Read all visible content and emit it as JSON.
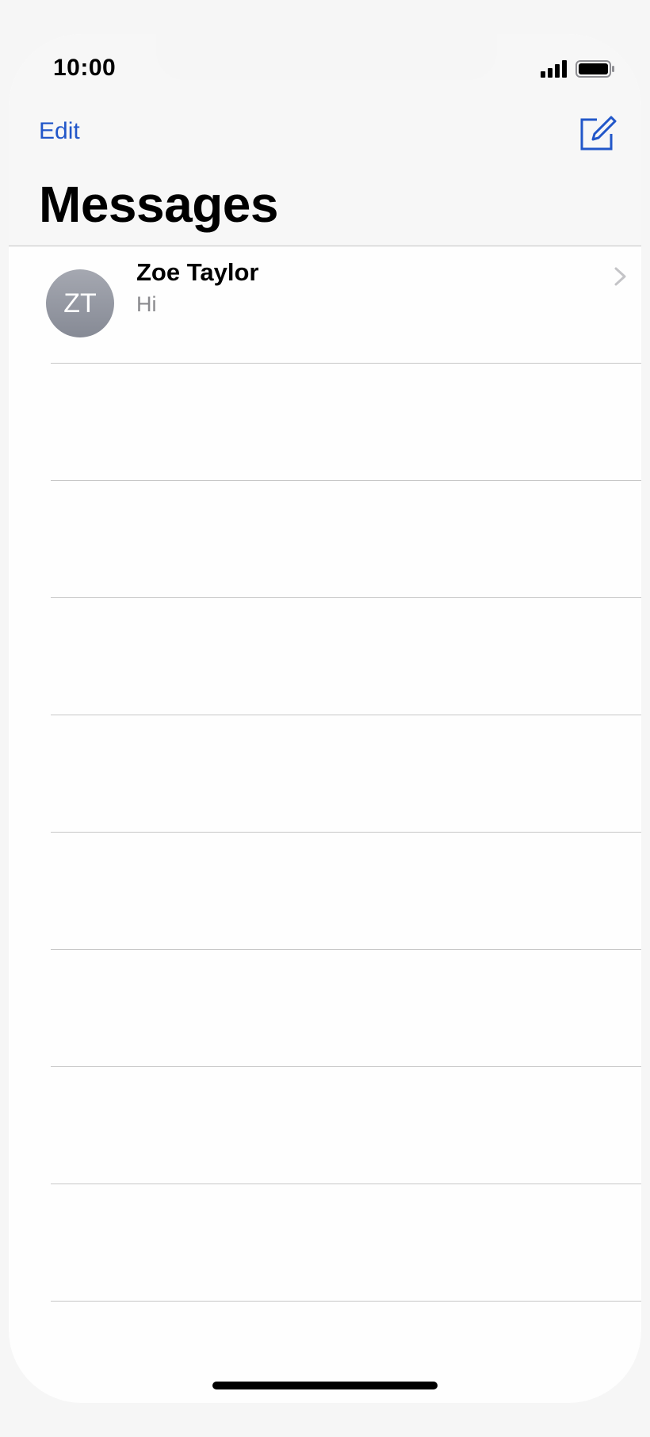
{
  "status_bar": {
    "time": "10:00"
  },
  "nav": {
    "edit_label": "Edit",
    "compose_icon": "compose-icon",
    "title": "Messages"
  },
  "conversations": [
    {
      "initials": "ZT",
      "name": "Zoe Taylor",
      "preview": "Hi"
    }
  ],
  "colors": {
    "accent": "#2257c9",
    "avatar": "#9a9da6"
  }
}
